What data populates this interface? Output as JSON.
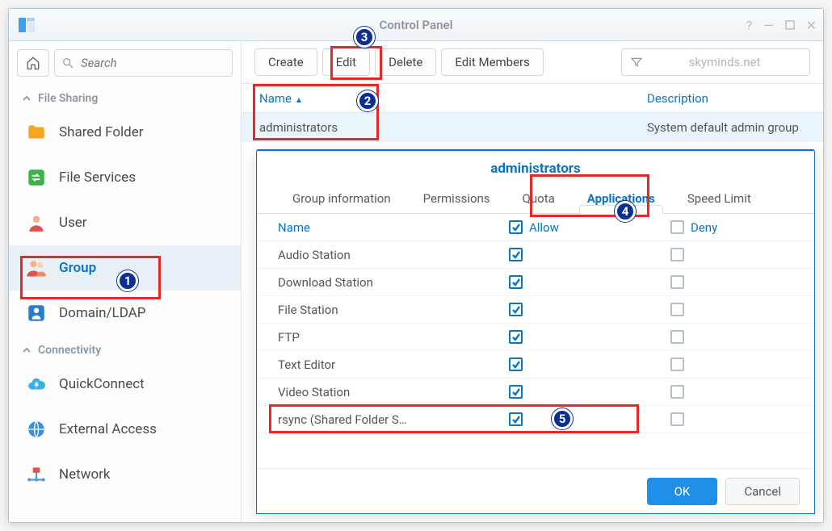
{
  "window": {
    "title": "Control Panel"
  },
  "search": {
    "placeholder": "Search"
  },
  "sections": {
    "fileSharing": "File Sharing",
    "connectivity": "Connectivity"
  },
  "sidebar": {
    "items": [
      {
        "label": "Shared Folder"
      },
      {
        "label": "File Services"
      },
      {
        "label": "User"
      },
      {
        "label": "Group"
      },
      {
        "label": "Domain/LDAP"
      }
    ],
    "conn": [
      {
        "label": "QuickConnect"
      },
      {
        "label": "External Access"
      },
      {
        "label": "Network"
      }
    ]
  },
  "toolbar": {
    "create": "Create",
    "edit": "Edit",
    "delete": "Delete",
    "editMembers": "Edit Members",
    "filterText": "skyminds.net"
  },
  "grid": {
    "nameHeader": "Name",
    "descHeader": "Description",
    "row": {
      "name": "administrators",
      "desc": "System default admin group"
    }
  },
  "modal": {
    "title": "administrators",
    "tabs": {
      "info": "Group information",
      "perms": "Permissions",
      "quota": "Quota",
      "apps": "Applications",
      "speed": "Speed Limit"
    },
    "cols": {
      "name": "Name",
      "allow": "Allow",
      "deny": "Deny"
    },
    "apps": [
      {
        "name": "Audio Station",
        "allow": true,
        "deny": false
      },
      {
        "name": "Download Station",
        "allow": true,
        "deny": false
      },
      {
        "name": "File Station",
        "allow": true,
        "deny": false
      },
      {
        "name": "FTP",
        "allow": true,
        "deny": false
      },
      {
        "name": "Text Editor",
        "allow": true,
        "deny": false
      },
      {
        "name": "Video Station",
        "allow": true,
        "deny": false
      },
      {
        "name": "rsync (Shared Folder S…",
        "allow": true,
        "deny": false
      }
    ],
    "ok": "OK",
    "cancel": "Cancel"
  }
}
